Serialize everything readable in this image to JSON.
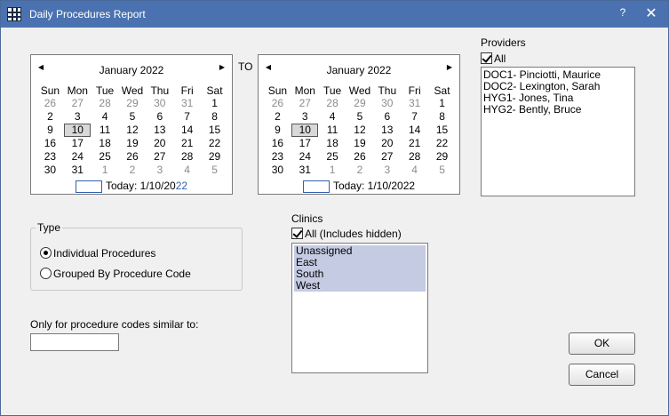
{
  "window": {
    "title": "Daily Procedures Report",
    "help": "?",
    "close": "✕"
  },
  "weekdays": [
    "Sun",
    "Mon",
    "Tue",
    "Wed",
    "Thu",
    "Fri",
    "Sat"
  ],
  "cal_from": {
    "month_title": "January 2022",
    "today_prefix": "Today: ",
    "today_date_a": "1/10/20",
    "today_date_b": "22"
  },
  "cal_to": {
    "month_title": "January 2022",
    "today_prefix": "Today: ",
    "today_date_a": "1/10/2022",
    "today_date_b": ""
  },
  "to_label": "TO",
  "calendar_weeks": [
    [
      {
        "d": "26",
        "g": true
      },
      {
        "d": "27",
        "g": true
      },
      {
        "d": "28",
        "g": true
      },
      {
        "d": "29",
        "g": true
      },
      {
        "d": "30",
        "g": true
      },
      {
        "d": "31",
        "g": true
      },
      {
        "d": "1"
      }
    ],
    [
      {
        "d": "2"
      },
      {
        "d": "3"
      },
      {
        "d": "4"
      },
      {
        "d": "5"
      },
      {
        "d": "6"
      },
      {
        "d": "7"
      },
      {
        "d": "8"
      }
    ],
    [
      {
        "d": "9"
      },
      {
        "d": "10",
        "sel": true
      },
      {
        "d": "11"
      },
      {
        "d": "12"
      },
      {
        "d": "13"
      },
      {
        "d": "14"
      },
      {
        "d": "15"
      }
    ],
    [
      {
        "d": "16"
      },
      {
        "d": "17"
      },
      {
        "d": "18"
      },
      {
        "d": "19"
      },
      {
        "d": "20"
      },
      {
        "d": "21"
      },
      {
        "d": "22"
      }
    ],
    [
      {
        "d": "23"
      },
      {
        "d": "24"
      },
      {
        "d": "25"
      },
      {
        "d": "26"
      },
      {
        "d": "27"
      },
      {
        "d": "28"
      },
      {
        "d": "29"
      }
    ],
    [
      {
        "d": "30"
      },
      {
        "d": "31"
      },
      {
        "d": "1",
        "g": true
      },
      {
        "d": "2",
        "g": true
      },
      {
        "d": "3",
        "g": true
      },
      {
        "d": "4",
        "g": true
      },
      {
        "d": "5",
        "g": true
      }
    ]
  ],
  "providers": {
    "label": "Providers",
    "all_label": "All",
    "items": [
      "DOC1- Pinciotti, Maurice",
      "DOC2- Lexington, Sarah",
      "HYG1- Jones, Tina",
      "HYG2- Bently, Bruce"
    ]
  },
  "type": {
    "title": "Type",
    "options": [
      "Individual Procedures",
      "Grouped By Procedure Code"
    ],
    "selected": 0
  },
  "clinics": {
    "label": "Clinics",
    "all_label": "All (Includes hidden)",
    "items": [
      "Unassigned",
      "East",
      "South",
      "West"
    ]
  },
  "codes": {
    "label": "Only for procedure codes similar to:",
    "value": ""
  },
  "buttons": {
    "ok": "OK",
    "cancel": "Cancel"
  },
  "colors": {
    "titlebar": "#4a72b0",
    "selection": "#c5cbe3",
    "today_accent": "#3060b0"
  }
}
